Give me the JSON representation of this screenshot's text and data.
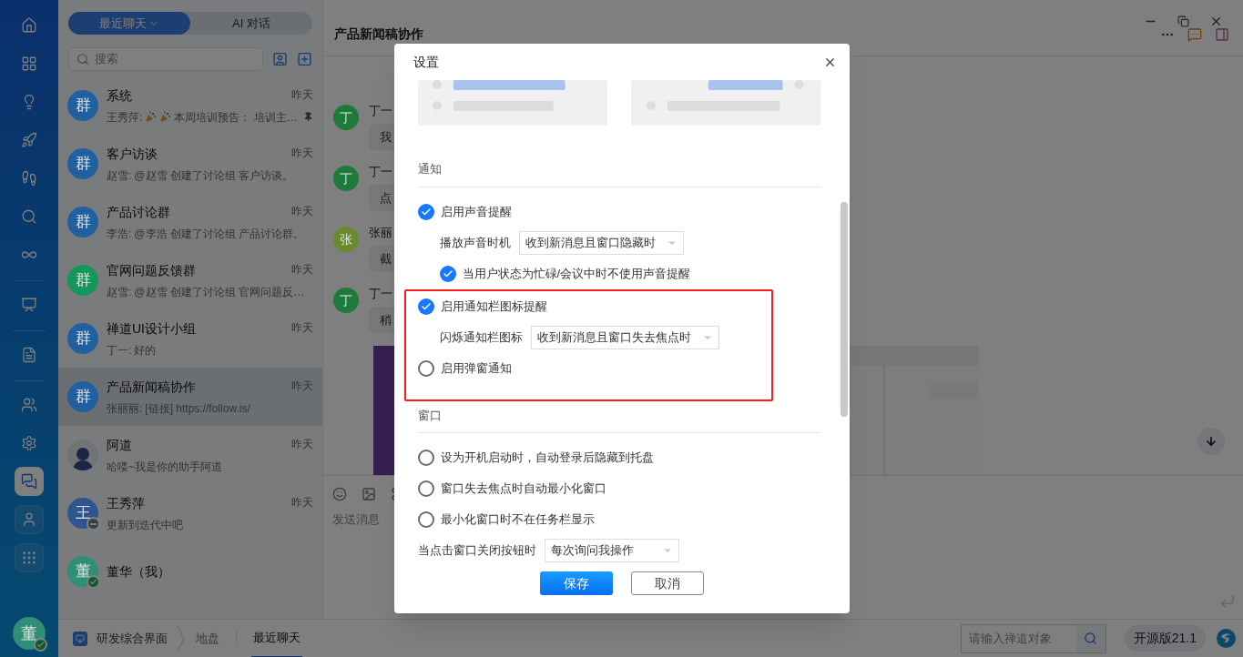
{
  "rail": {
    "items": [
      {
        "selected": false
      },
      {
        "selected": false
      },
      {
        "selected": false
      },
      {
        "selected": false
      },
      {
        "selected": false
      },
      {
        "selected": false
      },
      {
        "selected": false
      },
      {
        "selected": false
      },
      {
        "selected": false
      },
      {
        "selected": false
      },
      {
        "selected": false
      },
      {
        "selected": true
      },
      {
        "selected": false
      },
      {
        "selected": false
      }
    ],
    "user": {
      "avatar": "董",
      "color": "#2f8f76",
      "online": true
    }
  },
  "chat_list": {
    "tabs": [
      {
        "label": "最近聊天",
        "selected": true
      },
      {
        "label": "AI 对话",
        "selected": false
      }
    ],
    "search": {
      "placeholder": "搜索"
    },
    "items": [
      {
        "avatar": "群",
        "kind": "group",
        "color": "#1f60a0",
        "name": "系统",
        "time": "昨天",
        "sender": "王秀萍:",
        "emoji": true,
        "preview": "本周培训预告： 培训主…",
        "pinned": true,
        "selected": false
      },
      {
        "avatar": "群",
        "kind": "group",
        "color": "#1f60a0",
        "name": "客户访谈",
        "time": "昨天",
        "sender": "赵雪:",
        "preview": "@赵雪 创建了讨论组 客户访谈。",
        "selected": false
      },
      {
        "avatar": "群",
        "kind": "group",
        "color": "#1f60a0",
        "name": "产品讨论群",
        "time": "昨天",
        "sender": "李浩:",
        "preview": "@李浩 创建了讨论组 产品讨论群。",
        "selected": false
      },
      {
        "avatar": "群",
        "kind": "group",
        "color": "#12985a",
        "name": "官网问题反馈群",
        "time": "昨天",
        "sender": "赵雪:",
        "preview": "@赵雪 创建了讨论组 官网问题反…",
        "selected": false
      },
      {
        "avatar": "群",
        "kind": "group",
        "color": "#1f60a0",
        "name": "禅道UI设计小组",
        "time": "昨天",
        "sender": "丁一:",
        "preview": "好的",
        "selected": false
      },
      {
        "avatar": "群",
        "kind": "group",
        "color": "#1f60a0",
        "name": "产品新闻稿协作",
        "time": "昨天",
        "sender": "张丽丽:",
        "preview": "[链接] https://follow.is/",
        "selected": true
      },
      {
        "kind": "bot",
        "name": "阿道",
        "time": "昨天",
        "preview": "哈喽~我是你的助手阿道",
        "selected": false
      },
      {
        "avatar": "王",
        "kind": "person",
        "color": "#2f558f",
        "busy": true,
        "name": "王秀萍",
        "time": "昨天",
        "preview": "更新到迭代中吧",
        "selected": false
      },
      {
        "avatar": "董",
        "kind": "person",
        "color": "#2f8f76",
        "online": true,
        "name": "董华（我）",
        "selected": false
      }
    ]
  },
  "chat": {
    "title": "产品新闻稿协作",
    "messages": [
      {
        "avatar": "丁",
        "color": "#1d7a3a",
        "name": "丁一",
        "text": "我"
      },
      {
        "avatar": "丁",
        "color": "#1d7a3a",
        "name": "丁一",
        "text": "点"
      },
      {
        "avatar": "张",
        "color": "#6a8a30",
        "name": "张丽",
        "text": "截"
      },
      {
        "avatar": "丁",
        "color": "#1d7a3a",
        "name": "丁一",
        "text": "稍"
      }
    ],
    "composer": {
      "placeholder": "发送消息"
    }
  },
  "bottom_bar": {
    "crumbs": [
      {
        "label": "研发综合界面",
        "selected": false
      },
      {
        "label": "地盘",
        "selected": false
      },
      {
        "label": "最近聊天",
        "selected": true
      }
    ],
    "search": {
      "placeholder": "请输入禅道对象"
    },
    "edition": "开源版21.1"
  },
  "dialog": {
    "title": "设置",
    "sections": [
      {
        "title": "通知",
        "items": [
          {
            "kind": "check",
            "label": "启用声音提醒",
            "checked": true,
            "indent": false,
            "highlighted": false
          },
          {
            "kind": "select",
            "label": "播放声音时机",
            "value": "收到新消息且窗口隐藏时",
            "indent": true,
            "highlighted": false
          },
          {
            "kind": "check",
            "label": "当用户状态为忙碌/会议中时不使用声音提醒",
            "checked": true,
            "indent": true,
            "highlighted": false
          },
          {
            "kind": "check",
            "label": "启用通知栏图标提醒",
            "checked": true,
            "indent": false,
            "highlighted": true
          },
          {
            "kind": "select",
            "label": "闪烁通知栏图标",
            "value": "收到新消息且窗口失去焦点时",
            "indent": true,
            "highlighted": true
          },
          {
            "kind": "check",
            "label": "启用弹窗通知",
            "checked": false,
            "indent": false,
            "highlighted": true
          }
        ]
      },
      {
        "title": "窗口",
        "items": [
          {
            "kind": "check",
            "label": "设为开机启动时，自动登录后隐藏到托盘",
            "checked": false,
            "indent": false,
            "highlighted": false
          },
          {
            "kind": "check",
            "label": "窗口失去焦点时自动最小化窗口",
            "checked": false,
            "indent": false,
            "highlighted": false
          },
          {
            "kind": "check",
            "label": "最小化窗口时不在任务栏显示",
            "checked": false,
            "indent": false,
            "highlighted": false
          },
          {
            "kind": "select",
            "label": "当点击窗口关闭按钮时",
            "value": "每次询问我操作",
            "indent": false,
            "highlighted": false
          }
        ]
      }
    ],
    "buttons": [
      {
        "label": "保存",
        "kind": "primary"
      },
      {
        "label": "取消",
        "kind": "secondary"
      }
    ]
  }
}
